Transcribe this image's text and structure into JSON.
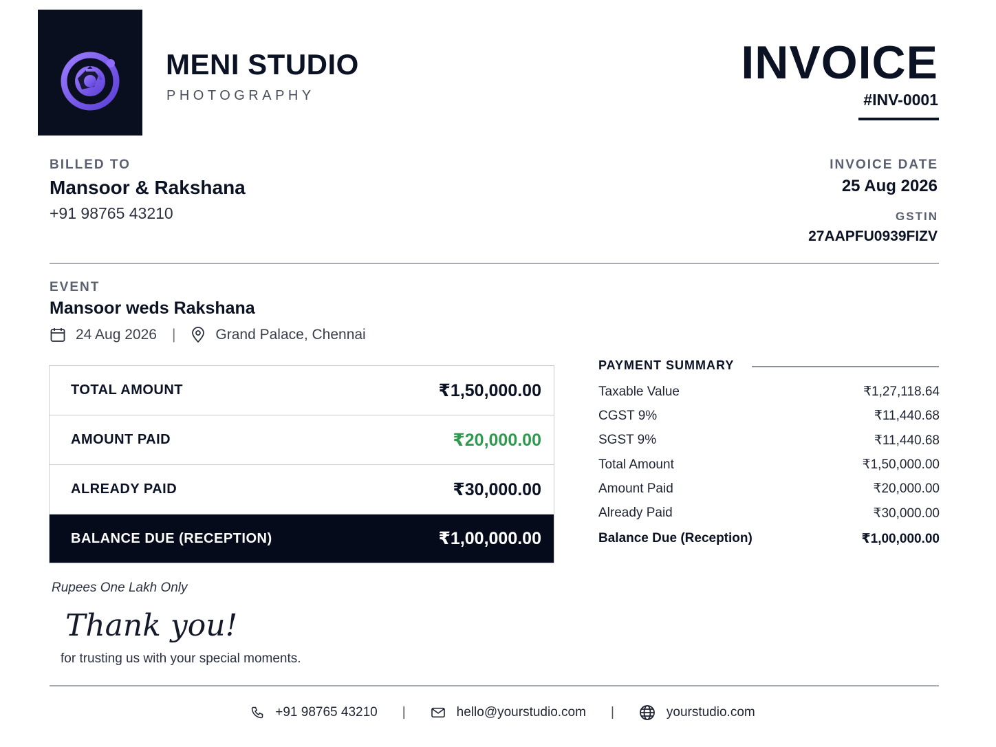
{
  "brand": {
    "name": "MENI STUDIO",
    "tagline": "PHOTOGRAPHY",
    "logo_icon": "camera-aperture-icon",
    "accent": "#7c5cf0"
  },
  "invoice": {
    "title": "INVOICE",
    "number": "#INV-0001",
    "date_label": "INVOICE DATE",
    "date": "25 Aug 2026",
    "gstin_label": "GSTIN",
    "gstin": "27AAPFU0939FIZV"
  },
  "billed": {
    "label": "BILLED TO",
    "name": "Mansoor & Rakshana",
    "phone": "+91 98765 43210"
  },
  "event": {
    "label": "EVENT",
    "name": "Mansoor weds Rakshana",
    "date": "24 Aug 2026",
    "separator": "|",
    "venue": "Grand Palace, Chennai",
    "date_icon": "calendar-icon",
    "venue_icon": "location-pin-icon"
  },
  "amounts": [
    {
      "label": "TOTAL AMOUNT",
      "value": "₹1,50,000.00"
    },
    {
      "label": "AMOUNT PAID",
      "value": "₹20,000.00",
      "color": "#2f9a4f"
    },
    {
      "label": "ALREADY PAID",
      "value": "₹30,000.00"
    },
    {
      "label": "BALANCE DUE (RECEPTION)",
      "value": "₹1,00,000.00"
    }
  ],
  "amount_in_words": "Rupees One Lakh Only",
  "thanks": {
    "script": "Thank you!",
    "message": "for trusting us with your special moments."
  },
  "summary": {
    "title": "PAYMENT SUMMARY",
    "rows": [
      {
        "label": "Taxable Value",
        "value": "₹1,27,118.64"
      },
      {
        "label": "CGST 9%",
        "value": "₹11,440.68"
      },
      {
        "label": "SGST 9%",
        "value": "₹11,440.68"
      },
      {
        "label": "Total Amount",
        "value": "₹1,50,000.00"
      },
      {
        "label": "Amount Paid",
        "value": "₹20,000.00"
      },
      {
        "label": "Already Paid",
        "value": "₹30,000.00"
      },
      {
        "label": "Balance Due (Reception)",
        "value": "₹1,00,000.00"
      }
    ]
  },
  "footer": {
    "phone": "+91 98765 43210",
    "email": "hello@yourstudio.com",
    "website": "yourstudio.com",
    "separator": "|",
    "phone_icon": "phone-icon",
    "email_icon": "mail-icon",
    "web_icon": "globe-icon"
  }
}
